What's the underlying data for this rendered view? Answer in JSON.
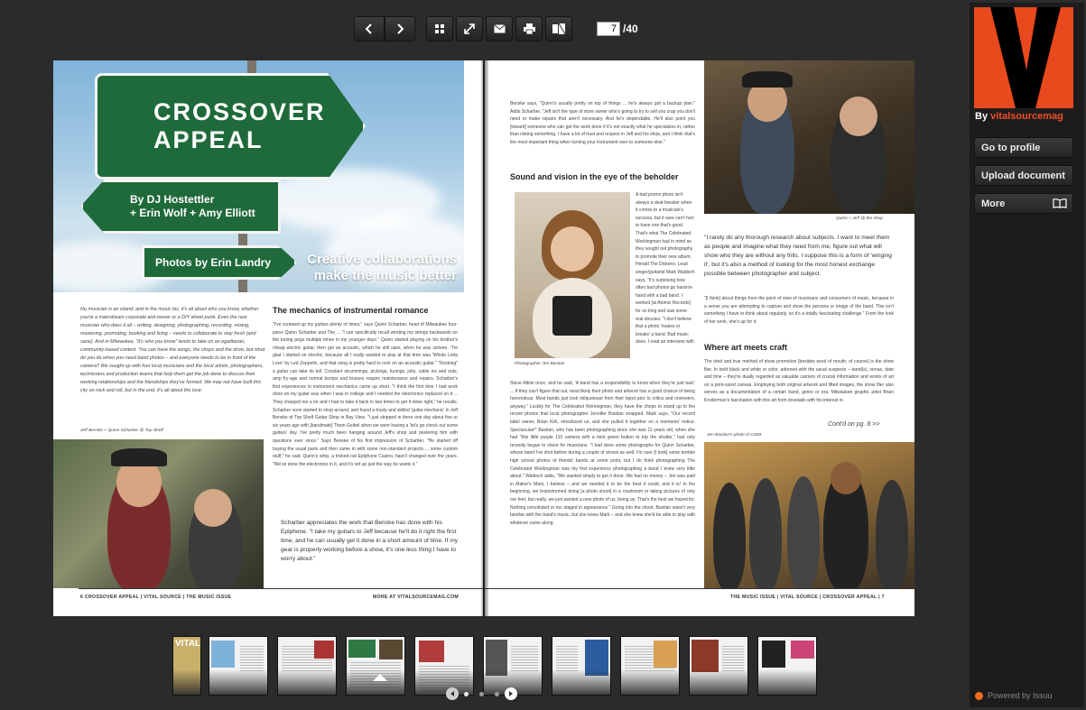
{
  "toolbar": {
    "prev_icon": "chevron-left-icon",
    "next_icon": "chevron-right-icon",
    "grid_icon": "grid-icon",
    "fullscreen_icon": "fullscreen-icon",
    "email_icon": "email-icon",
    "print_icon": "print-icon",
    "layout_icon": "layout-icon",
    "current_page": "7",
    "total_pages": "/40"
  },
  "left_page": {
    "headline_1": "CROSSOVER",
    "headline_2": "APPEAL",
    "byline_1": "By DJ Hostettler",
    "byline_2": "+ Erin Wolf + Amy Elliott",
    "photo_credit": "Photos by Erin Landry",
    "tagline_1": "Creative collaborations",
    "tagline_2": "make the music better",
    "intro": "No musician is an island; and in the music biz, it's all about who you know, whether you're a mainstream corporate anti-mover or a DIY street punk. Even the rare musician who does it all – writing, designing, photographing, recording, mixing, mastering, promoting, booking and living – needs to collaborate to stay fresh (and sane). And in Milwaukee, \"it's who you know\" tends to take on an egalitarian, community-based context. You can have the songs, the chops and the drive, but what do you do when you need band photos – and everyone needs to be in front of the camera? We sought up with four local musicians and the local artists, photographers, technicians and production teams that help them get the job done to discuss their working relationships and the friendships they've formed. We may not have built this city on rock and roll, but in the end, it's all about the love.",
    "photo_caption": "Jeff Benske + Quinn Scharber @ Top Shelf",
    "section_head": "The mechanics of instrumental romance",
    "body": "\"I've screwed up my guitars plenty of times,\" says Quinn Scharber, head of Milwaukee four-piece Quinn Scharber and The ... \"I can specifically recall winding my strings backwards on the tuning pegs multiple times in my younger days.\" Quinn started playing on his brother's cheap electric guitar, then got an acoustic, which he still uses, when he was sixteen. \"I'm glad I started on electric, because all I really wanted to play at that time was 'Whole Lotta Love' by Led Zeppelin, and that song is pretty hard to rock on an acoustic guitar.\" \"Rocking\" a guitar can take its toll. Constant strummings, pickings, tunings, jolts, cable ins and outs, amp fry-age and normal bumps and bruises require maintenance and repairs. Scharber's first experiences in instrument mechanics came up short. \"I think the first time I had work done on my guitar was when I was in college and I needed the electronics replaced on it ... They charged me a lot and I had to take it back in two times to get it done right,\" he recalls. Scharber soon started to shop around, and found a trusty and skilled 'guitar mechanic' in Jeff Benske of Top Shelf Guitar Shop in Bay View. \"I just stopped in there one day about five or six years ago with [bandmate] Thom Geibel when we were having a 'let's go check out some guitars' day. I've pretty much been hanging around Jeff's shop and pestering him with questions ever since.\" Says Benske of his first impression of Scharber, \"He started off buying the usual parts and then came in with some non-standard projects ... some custom stuff,\" he said. Quinn's whip, a tricked-out Epiphone Casino, hasn't changed over the years. \"We've done the electronics in it, and it's set up just the way he wants it.\"",
    "pull_quote": "Scharber appreciates the work that Benske has done with his Epiphone. \"I take my guitars to Jeff because he'll do it right the first time, and he can usually get it done in a short amount of time. If my gear is properly working before a show, it's one less thing I have to worry about.\"",
    "footer_left": "6  CROSSOVER APPEAL  |  VITAL SOURCE  |  THE MUSIC ISSUE",
    "footer_right": "MORE AT VITALSOURCEMAG.COM"
  },
  "right_page": {
    "col1_top": "Benske says, \"Quinn's usually pretty on top of things ... he's always got a backup plan.\" Adds Scharber, \"Jeff isn't the type of store owner who's going to try to sell you crap you don't need or make repairs that aren't necessary. And he's dependable. He'll also point you [toward] someone who can get the work done if it's not exactly what he specializes in, rather than risking something. I have a lot of trust and respect in Jeff and his shop, and I think that's the most important thing when turning your instrument over to someone else.\"",
    "section_head": "Sound and vision in the eye of the beholder",
    "photo_caption_left": "Photographer Jen Bastian",
    "side_text": "A bad promo photo isn't always a deal-breaker when it comes to a musician's success, but it sure can't hurt to have one that's good. That's what The Celebrated Workingman had in mind as they sought out photography to promote their new album, Herald The Dickens. Lead singer/guitarist Mark Waldoch says, \"It's surprising how often bad photos go hand-in-hand with a bad band. I worked [at Atomic Records] for so long and saw some real doozies. \"I don't believe that a photo 'makes or breaks' a band. Bad music does. I read an interview with",
    "col1_bottom": "Steve Albini once, and he said, 'A band has a responsibility to know when they're just bad.' ... If they can't figure that out, most likely their photo and artwork has a good chance of being horrendous. Most bands just look milquetoast from their band pics to critics and reviewers, anyway.\" Luckily for The Celebrated Workingman, they have the chops to stand up to the recent photos that local photographer Jennifer Bastian snapped. Mark says, \"Our record label owner, Brian Kirk, introduced us, and she pulled it together on a moments' notice. Spectacular!\" Bastian, who has been photographing since she was 11 years old, when she had \"this little purple 110 camera with a mint green button to trip the shutter,\" had only recently begun to shoot for musicians. \"I had done some photographs for Quinn Scharber, whose band I've shot before during a couple of shows as well. I'm sure [I took] some terrible high school photos of friends' bands at some point, but I do think photographing The Celebrated Workingman was my first experience photographing a band I knew very little about.\" Waldoch adds, \"We wanted simply to get it done. We had no money – Jen was paid in Maker's Mark, I believe – and we needed it to be the best it could, and it is! In the beginning, we brainstormed doing [a photo shoot] in a courtroom or taking pictures of only our feet, but really, we just wanted a new photo of us, being us. That's the best we hoped for. Nothing convoluted or too staged in appearance.\" Going into the shoot, Bastian wasn't very familiar with the band's music, but she knew Mark – and she knew she'd be able to play with whatever came along.",
    "photo_caption_top": "Quinn + Jeff @ the shop",
    "pull_quote": "\"I rarely do any thorough research about subjects. I want to meet them as people and imagine what they need from me, figure out what will show who they are without any frills. I suppose this is a form of 'winging it', but it's also a method of looking for the most honest exchange possible between photographer and subject.",
    "pull_quote_2": "\"[I think] about things from the point of view of musicians and consumers of music, because in a sense you are attempting to capture and show the persona or image of the band. This isn't something I have to think about regularly, so it's a totally fascinating challenge.\" From the look of her work, she's up for it.",
    "section_head_2": "Where art meets craft",
    "col2_bottom": "The tried and true method of show promotion [besides word of mouth, of course] is the show flier. In bold black and white or color, adorned with the usual suspects – band(s), venue, date and time – they're dually regarded as valuable carriers of crucial information and works of art on a print-sized canvas. Employing both original artwork and lifted images, the show flier also serves as a documentation of a certain band, genre or era. Milwaukee graphic artist Brian Kroderman's fascination with this art form dovetails with his interest in",
    "contd": "Cont'd on pg. 8 >>",
    "photo_caption_bottom": "Jen Bastian's photo of CWM",
    "footer": "THE MUSIC ISSUE  |  VITAL SOURCE  |  CROSSOVER APPEAL  |  7"
  },
  "thumbs": {
    "cover_title": "VITAL"
  },
  "sidebar": {
    "by": "By",
    "publisher": "vitalsourcemag",
    "go_to_profile": "Go to profile",
    "upload_document": "Upload document",
    "more": "More",
    "book_icon": "book-icon",
    "powered_by": "Powered by Issuu",
    "brand_color": "#e8491d"
  },
  "pager": {
    "prev_icon": "circle-left-icon",
    "next_icon": "circle-right-icon"
  }
}
